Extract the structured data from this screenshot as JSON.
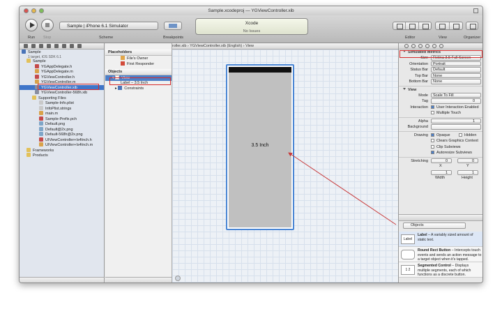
{
  "titlebar": {
    "title": "Sample.xcodeproj — YGViewController.xib"
  },
  "toolbar": {
    "run_label": "Run",
    "stop_label": "Stop",
    "scheme_value": "Sample  |  iPhone 6.1 Simulator",
    "scheme_label": "Scheme",
    "breakpoints_label": "Breakpoints",
    "activity_title": "Xcode",
    "activity_status": "No Issues",
    "editor_label": "Editor",
    "view_label": "View",
    "organizer_label": "Organizer"
  },
  "jumpbar": {
    "path": "◂  ▸  |  Sample  ›  Sample  ›  YGViewController.xib  ›  YGViewController.xib (English)  ›  View"
  },
  "navigator": {
    "items": [
      {
        "label": "Sample",
        "sub": "1 target, iOS SDK 6.1",
        "icon": "project"
      },
      {
        "label": "Sample",
        "icon": "folder"
      },
      {
        "label": "YGAppDelegate.h",
        "icon": "h"
      },
      {
        "label": "YGAppDelegate.m",
        "icon": "m"
      },
      {
        "label": "YGViewController.h",
        "icon": "h"
      },
      {
        "label": "YGViewController.m",
        "icon": "m"
      },
      {
        "label": "YGViewController.xib",
        "icon": "xib"
      },
      {
        "label": "YGViewController-568h.xib",
        "icon": "xib"
      },
      {
        "label": "Supporting Files",
        "icon": "folder"
      },
      {
        "label": "Sample-Info.plist",
        "icon": "file"
      },
      {
        "label": "InfoPlist.strings",
        "icon": "file"
      },
      {
        "label": "main.m",
        "icon": "m"
      },
      {
        "label": "Sample-Prefix.pch",
        "icon": "h"
      },
      {
        "label": "Default.png",
        "icon": "png"
      },
      {
        "label": "Default@2x.png",
        "icon": "png"
      },
      {
        "label": "Default-568h@2x.png",
        "icon": "png"
      },
      {
        "label": "UIViewController+Is4Inch.h",
        "icon": "h"
      },
      {
        "label": "UIViewController+Is4Inch.m",
        "icon": "m"
      },
      {
        "label": "Frameworks",
        "icon": "folder"
      },
      {
        "label": "Products",
        "icon": "folder"
      }
    ]
  },
  "outline": {
    "placeholders_header": "Placeholders",
    "files_owner": "File's Owner",
    "first_responder": "First Responder",
    "objects_header": "Objects",
    "view": "View",
    "label_item": "Label – 3.5 Inch",
    "constraints": "Constraints"
  },
  "canvas": {
    "label_text": "3.5 Inch"
  },
  "inspector": {
    "simulated_metrics": "Simulated Metrics",
    "size_key": "Size",
    "size_val": "Retina 3.5 Full Screen",
    "orientation_key": "Orientation",
    "orientation_val": "Portrait",
    "statusbar_key": "Status Bar",
    "statusbar_val": "Default",
    "topbar_key": "Top Bar",
    "topbar_val": "None",
    "bottombar_key": "Bottom Bar",
    "bottombar_val": "None",
    "view_section": "View",
    "mode_key": "Mode",
    "mode_val": "Scale To Fill",
    "tag_key": "Tag",
    "tag_val": "0",
    "interaction_key": "Interaction",
    "uie": "User Interaction Enabled",
    "mt": "Multiple Touch",
    "alpha_key": "Alpha",
    "alpha_val": "1",
    "background_key": "Background",
    "drawing_key": "Drawing",
    "opaque": "Opaque",
    "hidden": "Hidden",
    "cgc": "Clears Graphics Context",
    "clip": "Clip Subviews",
    "autoresize": "Autoresize Subviews",
    "stretching_key": "Stretching",
    "x_label": "X",
    "y_label": "Y",
    "width_label": "Width",
    "height_label": "Height",
    "s0": "0",
    "s1": "1",
    "library_select": "Objects",
    "lib": [
      {
        "icon": "Label",
        "title": "Label",
        "desc": " – A variably sized amount of static text."
      },
      {
        "icon": "",
        "title": "Round Rect Button",
        "desc": " – Intercepts touch events and sends an action message to a target object when it's tapped."
      },
      {
        "icon": "1  2",
        "title": "Segmented Control",
        "desc": " – Displays multiple segments, each of which functions as a discrete button."
      }
    ]
  }
}
